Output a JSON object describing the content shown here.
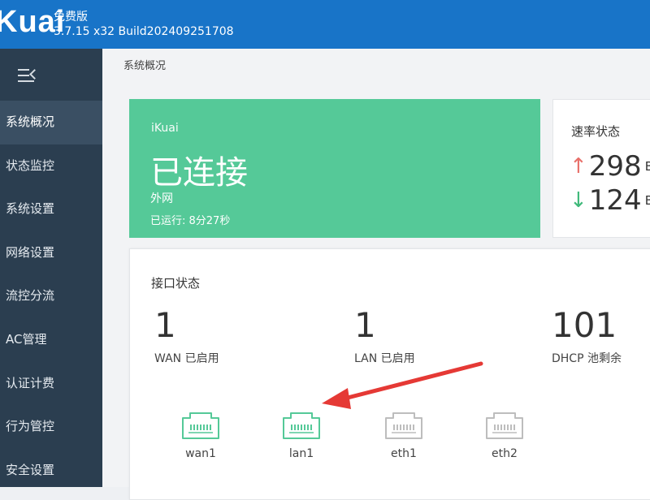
{
  "app": {
    "logo": "Kuai",
    "edition": "免费版",
    "build": "3.7.15 x32 Build202409251708"
  },
  "sidebar": {
    "items": [
      {
        "label": "系统概况",
        "active": true
      },
      {
        "label": "状态监控",
        "active": false
      },
      {
        "label": "系统设置",
        "active": false
      },
      {
        "label": "网络设置",
        "active": false
      },
      {
        "label": "流控分流",
        "active": false
      },
      {
        "label": "AC管理",
        "active": false
      },
      {
        "label": "认证计费",
        "active": false
      },
      {
        "label": "行为管控",
        "active": false
      },
      {
        "label": "安全设置",
        "active": false
      }
    ]
  },
  "breadcrumb": "系统概况",
  "connection": {
    "brand": "iKuai",
    "status": "已连接",
    "network": "外网",
    "uptime": "已运行: 8分27秒"
  },
  "rate": {
    "title": "速率状态",
    "upload_value": "298",
    "upload_unit": "B/",
    "download_value": "124",
    "download_unit": "B/",
    "up_arrow": "↑",
    "down_arrow": "↓"
  },
  "interfaces": {
    "title": "接口状态",
    "stats": [
      {
        "value": "1",
        "label": "WAN 已启用"
      },
      {
        "value": "1",
        "label": "LAN 已启用"
      },
      {
        "value": "101",
        "label": "DHCP 池剩余"
      }
    ],
    "ports": [
      {
        "name": "wan1",
        "icon": "ethernet-port-icon",
        "color": "#55c998"
      },
      {
        "name": "lan1",
        "icon": "ethernet-port-icon",
        "color": "#55c998"
      },
      {
        "name": "eth1",
        "icon": "ethernet-port-icon",
        "color": "#bdbdbd"
      },
      {
        "name": "eth2",
        "icon": "ethernet-port-icon",
        "color": "#bdbdbd"
      }
    ]
  },
  "colors": {
    "topbar": "#1874c8",
    "sidebar": "#2b3e50",
    "connected_card": "#55c998",
    "annotation_arrow": "#e53935"
  }
}
